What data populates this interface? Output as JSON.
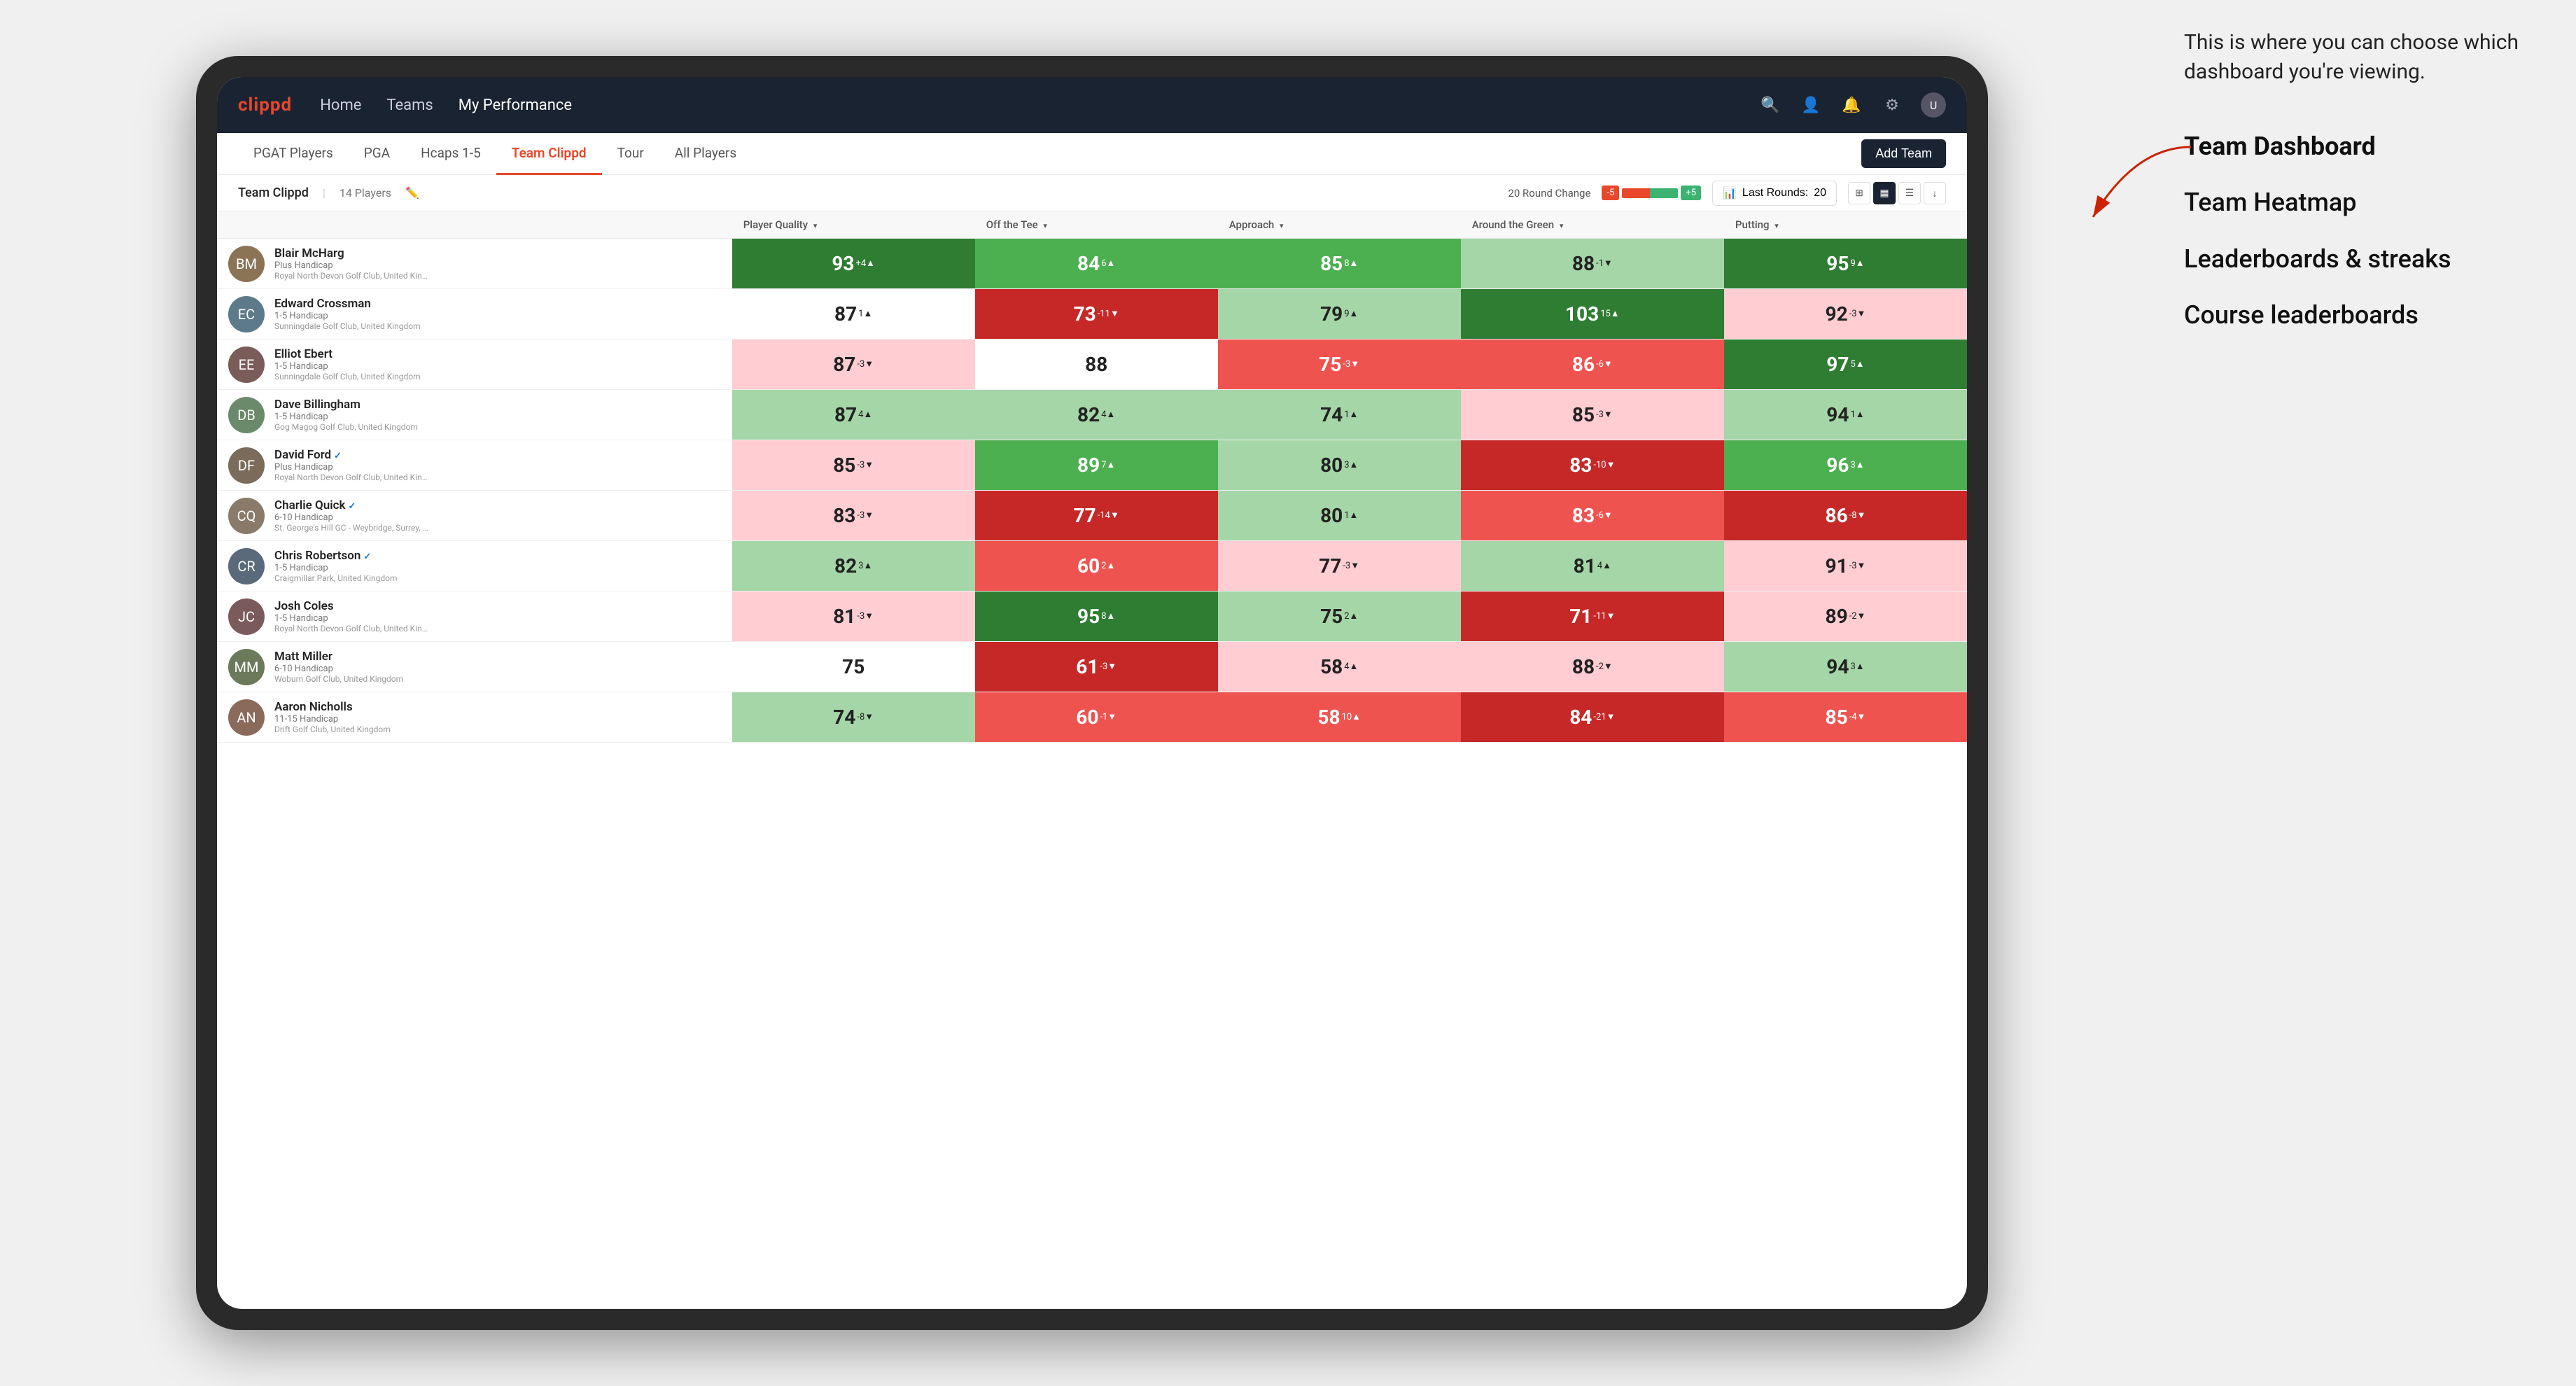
{
  "annotation": {
    "intro": "This is where you can choose which dashboard you're viewing.",
    "items": [
      {
        "label": "Team Dashboard",
        "active": true
      },
      {
        "label": "Team Heatmap",
        "active": false
      },
      {
        "label": "Leaderboards & streaks",
        "active": false
      },
      {
        "label": "Course leaderboards",
        "active": false
      }
    ]
  },
  "nav": {
    "logo": "clippd",
    "links": [
      {
        "label": "Home",
        "active": false
      },
      {
        "label": "Teams",
        "active": false
      },
      {
        "label": "My Performance",
        "active": true
      }
    ]
  },
  "sub_tabs": [
    {
      "label": "PGAT Players",
      "active": false
    },
    {
      "label": "PGA",
      "active": false
    },
    {
      "label": "Hcaps 1-5",
      "active": false
    },
    {
      "label": "Team Clippd",
      "active": true
    },
    {
      "label": "Tour",
      "active": false
    },
    {
      "label": "All Players",
      "active": false
    }
  ],
  "add_team_label": "Add Team",
  "team_bar": {
    "name": "Team Clippd",
    "separator": "|",
    "count": "14 Players",
    "round_change_label": "20 Round Change",
    "change_neg": "-5",
    "change_pos": "+5",
    "last_rounds_label": "Last Rounds:",
    "last_rounds_value": "20"
  },
  "table": {
    "columns": [
      {
        "label": "Player Quality ▾",
        "key": "quality"
      },
      {
        "label": "Off the Tee ▾",
        "key": "tee"
      },
      {
        "label": "Approach ▾",
        "key": "approach"
      },
      {
        "label": "Around the Green ▾",
        "key": "around"
      },
      {
        "label": "Putting ▾",
        "key": "putting"
      }
    ],
    "rows": [
      {
        "name": "Blair McHarg",
        "handicap": "Plus Handicap",
        "club": "Royal North Devon Golf Club, United Kingdom",
        "avatar_color": "#8B7355",
        "avatar_initials": "BM",
        "quality": {
          "value": 93,
          "delta": "+4",
          "dir": "up",
          "bg": "bg-green-dark"
        },
        "tee": {
          "value": 84,
          "delta": "6",
          "dir": "up",
          "bg": "bg-green-mid"
        },
        "approach": {
          "value": 85,
          "delta": "8",
          "dir": "up",
          "bg": "bg-green-mid"
        },
        "around": {
          "value": 88,
          "delta": "-1",
          "dir": "down",
          "bg": "bg-green-light"
        },
        "putting": {
          "value": 95,
          "delta": "9",
          "dir": "up",
          "bg": "bg-green-dark"
        }
      },
      {
        "name": "Edward Crossman",
        "handicap": "1-5 Handicap",
        "club": "Sunningdale Golf Club, United Kingdom",
        "avatar_color": "#5D7A8A",
        "avatar_initials": "EC",
        "quality": {
          "value": 87,
          "delta": "1",
          "dir": "up",
          "bg": "bg-white"
        },
        "tee": {
          "value": 73,
          "delta": "-11",
          "dir": "down",
          "bg": "bg-red-dark"
        },
        "approach": {
          "value": 79,
          "delta": "9",
          "dir": "up",
          "bg": "bg-green-light"
        },
        "around": {
          "value": 103,
          "delta": "15",
          "dir": "up",
          "bg": "bg-green-dark"
        },
        "putting": {
          "value": 92,
          "delta": "-3",
          "dir": "down",
          "bg": "bg-red-light"
        }
      },
      {
        "name": "Elliot Ebert",
        "handicap": "1-5 Handicap",
        "club": "Sunningdale Golf Club, United Kingdom",
        "avatar_color": "#7A5C58",
        "avatar_initials": "EE",
        "quality": {
          "value": 87,
          "delta": "-3",
          "dir": "down",
          "bg": "bg-red-light"
        },
        "tee": {
          "value": 88,
          "delta": "",
          "dir": "none",
          "bg": "bg-white"
        },
        "approach": {
          "value": 75,
          "delta": "-3",
          "dir": "down",
          "bg": "bg-red-mid"
        },
        "around": {
          "value": 86,
          "delta": "-6",
          "dir": "down",
          "bg": "bg-red-mid"
        },
        "putting": {
          "value": 97,
          "delta": "5",
          "dir": "up",
          "bg": "bg-green-dark"
        }
      },
      {
        "name": "Dave Billingham",
        "handicap": "1-5 Handicap",
        "club": "Gog Magog Golf Club, United Kingdom",
        "avatar_color": "#6B8A6B",
        "avatar_initials": "DB",
        "quality": {
          "value": 87,
          "delta": "4",
          "dir": "up",
          "bg": "bg-green-light"
        },
        "tee": {
          "value": 82,
          "delta": "4",
          "dir": "up",
          "bg": "bg-green-light"
        },
        "approach": {
          "value": 74,
          "delta": "1",
          "dir": "up",
          "bg": "bg-green-light"
        },
        "around": {
          "value": 85,
          "delta": "-3",
          "dir": "down",
          "bg": "bg-red-light"
        },
        "putting": {
          "value": 94,
          "delta": "1",
          "dir": "up",
          "bg": "bg-green-light"
        }
      },
      {
        "name": "David Ford",
        "handicap": "Plus Handicap",
        "club": "Royal North Devon Golf Club, United Kingdom",
        "avatar_color": "#7A6B5A",
        "avatar_initials": "DF",
        "verified": true,
        "quality": {
          "value": 85,
          "delta": "-3",
          "dir": "down",
          "bg": "bg-red-light"
        },
        "tee": {
          "value": 89,
          "delta": "7",
          "dir": "up",
          "bg": "bg-green-mid"
        },
        "approach": {
          "value": 80,
          "delta": "3",
          "dir": "up",
          "bg": "bg-green-light"
        },
        "around": {
          "value": 83,
          "delta": "-10",
          "dir": "down",
          "bg": "bg-red-dark"
        },
        "putting": {
          "value": 96,
          "delta": "3",
          "dir": "up",
          "bg": "bg-green-mid"
        }
      },
      {
        "name": "Charlie Quick",
        "handicap": "6-10 Handicap",
        "club": "St. George's Hill GC - Weybridge, Surrey, Uni...",
        "avatar_color": "#8A7A6A",
        "avatar_initials": "CQ",
        "verified": true,
        "quality": {
          "value": 83,
          "delta": "-3",
          "dir": "down",
          "bg": "bg-red-light"
        },
        "tee": {
          "value": 77,
          "delta": "-14",
          "dir": "down",
          "bg": "bg-red-dark"
        },
        "approach": {
          "value": 80,
          "delta": "1",
          "dir": "up",
          "bg": "bg-green-light"
        },
        "around": {
          "value": 83,
          "delta": "-6",
          "dir": "down",
          "bg": "bg-red-mid"
        },
        "putting": {
          "value": 86,
          "delta": "-8",
          "dir": "down",
          "bg": "bg-red-dark"
        }
      },
      {
        "name": "Chris Robertson",
        "handicap": "1-5 Handicap",
        "club": "Craigmillar Park, United Kingdom",
        "avatar_color": "#5A6A7A",
        "avatar_initials": "CR",
        "verified": true,
        "quality": {
          "value": 82,
          "delta": "3",
          "dir": "up",
          "bg": "bg-green-light"
        },
        "tee": {
          "value": 60,
          "delta": "2",
          "dir": "up",
          "bg": "bg-red-mid"
        },
        "approach": {
          "value": 77,
          "delta": "-3",
          "dir": "down",
          "bg": "bg-red-light"
        },
        "around": {
          "value": 81,
          "delta": "4",
          "dir": "up",
          "bg": "bg-green-light"
        },
        "putting": {
          "value": 91,
          "delta": "-3",
          "dir": "down",
          "bg": "bg-red-light"
        }
      },
      {
        "name": "Josh Coles",
        "handicap": "1-5 Handicap",
        "club": "Royal North Devon Golf Club, United Kingdom",
        "avatar_color": "#7A5A5A",
        "avatar_initials": "JC",
        "quality": {
          "value": 81,
          "delta": "-3",
          "dir": "down",
          "bg": "bg-red-light"
        },
        "tee": {
          "value": 95,
          "delta": "8",
          "dir": "up",
          "bg": "bg-green-dark"
        },
        "approach": {
          "value": 75,
          "delta": "2",
          "dir": "up",
          "bg": "bg-green-light"
        },
        "around": {
          "value": 71,
          "delta": "-11",
          "dir": "down",
          "bg": "bg-red-dark"
        },
        "putting": {
          "value": 89,
          "delta": "-2",
          "dir": "down",
          "bg": "bg-red-light"
        }
      },
      {
        "name": "Matt Miller",
        "handicap": "6-10 Handicap",
        "club": "Woburn Golf Club, United Kingdom",
        "avatar_color": "#6A7A5A",
        "avatar_initials": "MM",
        "quality": {
          "value": 75,
          "delta": "",
          "dir": "none",
          "bg": "bg-white"
        },
        "tee": {
          "value": 61,
          "delta": "-3",
          "dir": "down",
          "bg": "bg-red-dark"
        },
        "approach": {
          "value": 58,
          "delta": "4",
          "dir": "up",
          "bg": "bg-red-light"
        },
        "around": {
          "value": 88,
          "delta": "-2",
          "dir": "down",
          "bg": "bg-red-light"
        },
        "putting": {
          "value": 94,
          "delta": "3",
          "dir": "up",
          "bg": "bg-green-light"
        }
      },
      {
        "name": "Aaron Nicholls",
        "handicap": "11-15 Handicap",
        "club": "Drift Golf Club, United Kingdom",
        "avatar_color": "#8A6A5A",
        "avatar_initials": "AN",
        "quality": {
          "value": 74,
          "delta": "-8",
          "dir": "down",
          "bg": "bg-green-light"
        },
        "tee": {
          "value": 60,
          "delta": "-1",
          "dir": "down",
          "bg": "bg-red-mid"
        },
        "approach": {
          "value": 58,
          "delta": "10",
          "dir": "up",
          "bg": "bg-red-mid"
        },
        "around": {
          "value": 84,
          "delta": "-21",
          "dir": "down",
          "bg": "bg-red-dark"
        },
        "putting": {
          "value": 85,
          "delta": "-4",
          "dir": "down",
          "bg": "bg-red-mid"
        }
      }
    ]
  }
}
